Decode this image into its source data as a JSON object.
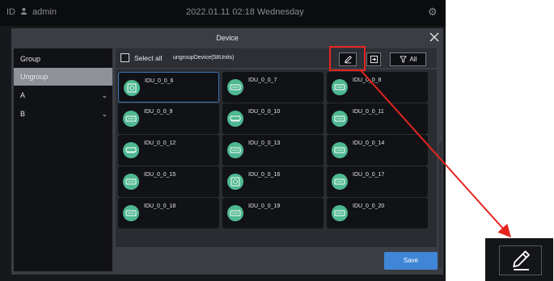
{
  "topbar": {
    "left_code": "ID",
    "user": "admin",
    "datetime": "2022.01.11 02:18 Wednesday",
    "icons": {
      "user": "user-icon",
      "settings": "gear-icon"
    }
  },
  "modal": {
    "title": "Device",
    "close_icon": "close-icon",
    "save_label": "Save"
  },
  "sidebar": {
    "items": [
      {
        "label": "Group",
        "active": false,
        "expandable": false
      },
      {
        "label": "Ungroup",
        "active": true,
        "expandable": false
      },
      {
        "label": "A",
        "active": false,
        "expandable": true
      },
      {
        "label": "B",
        "active": false,
        "expandable": true
      }
    ]
  },
  "toolbar": {
    "select_all_label": "Select all",
    "group_info": "ungroupDevice(58Units)",
    "edit_icon": "pencil-icon",
    "move_icon": "move-to-group-icon",
    "filter_icon": "filter-icon",
    "filter_label": "All"
  },
  "devices": [
    {
      "name": "IDU_0_0_6",
      "icon": "cassette-unit-icon",
      "selected": true
    },
    {
      "name": "IDU_0_0_7",
      "icon": "duct-unit-icon",
      "selected": false
    },
    {
      "name": "IDU_0_0_8",
      "icon": "duct-unit-icon",
      "selected": false
    },
    {
      "name": "IDU_0_0_9",
      "icon": "duct-unit-icon",
      "selected": false
    },
    {
      "name": "IDU_0_0_10",
      "icon": "wall-unit-icon",
      "selected": false
    },
    {
      "name": "IDU_0_0_11",
      "icon": "duct-unit-icon",
      "selected": false
    },
    {
      "name": "IDU_0_0_12",
      "icon": "wall-unit-icon",
      "selected": false
    },
    {
      "name": "IDU_0_0_13",
      "icon": "duct-unit-icon",
      "selected": false
    },
    {
      "name": "IDU_0_0_14",
      "icon": "duct-unit-icon",
      "selected": false
    },
    {
      "name": "IDU_0_0_15",
      "icon": "duct-unit-icon",
      "selected": false
    },
    {
      "name": "IDU_0_0_16",
      "icon": "cassette-unit-icon",
      "selected": false
    },
    {
      "name": "IDU_0_0_17",
      "icon": "duct-unit-icon",
      "selected": false
    },
    {
      "name": "IDU_0_0_18",
      "icon": "duct-unit-icon",
      "selected": false
    },
    {
      "name": "IDU_0_0_19",
      "icon": "duct-unit-icon",
      "selected": false
    },
    {
      "name": "IDU_0_0_20",
      "icon": "duct-unit-icon",
      "selected": false
    }
  ],
  "callout": {
    "icon": "pencil-icon",
    "highlight_color": "#e52620"
  },
  "colors": {
    "accent": "#3f86d6",
    "device_icon": "#4fb892",
    "selected_border": "#3b76b8"
  }
}
